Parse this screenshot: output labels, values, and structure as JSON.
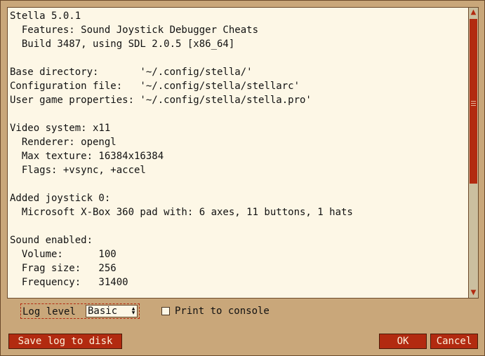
{
  "log": {
    "lines": [
      "Stella 5.0.1",
      "  Features: Sound Joystick Debugger Cheats",
      "  Build 3487, using SDL 2.0.5 [x86_64]",
      "",
      "Base directory:       '~/.config/stella/'",
      "Configuration file:   '~/.config/stella/stellarc'",
      "User game properties: '~/.config/stella/stella.pro'",
      "",
      "Video system: x11",
      "  Renderer: opengl",
      "  Max texture: 16384x16384",
      "  Flags: +vsync, +accel",
      "",
      "Added joystick 0:",
      "  Microsoft X-Box 360 pad with: 6 axes, 11 buttons, 1 hats",
      "",
      "Sound enabled:",
      "  Volume:      100",
      "  Frag size:   256",
      "  Frequency:   31400"
    ]
  },
  "scrollbar": {
    "up_icon": "triangle-up",
    "down_icon": "triangle-down",
    "up_glyph": "▲",
    "down_glyph": "▼"
  },
  "controls": {
    "log_level_label": "Log level",
    "log_level_value": "Basic",
    "print_to_console_label": "Print to console",
    "print_to_console_checked": false
  },
  "buttons": {
    "save_log": "Save log to disk",
    "ok": "OK",
    "cancel": "Cancel"
  },
  "colors": {
    "dialog_bg": "#c9a77a",
    "panel_bg": "#fdf7e6",
    "accent": "#b22a10"
  }
}
